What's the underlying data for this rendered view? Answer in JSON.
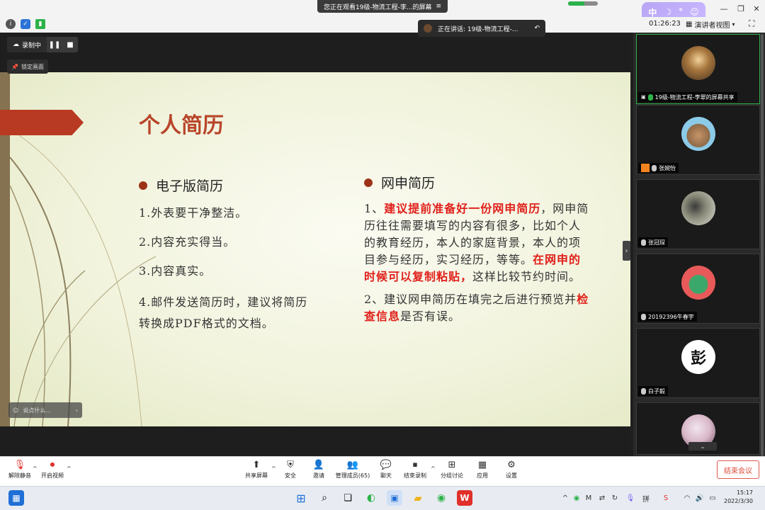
{
  "window": {
    "share_banner": "您正在观看19级-物流工程-李...的屏幕",
    "ime": [
      "中",
      "☽",
      "°",
      "☺"
    ],
    "signal_level": 0.55
  },
  "toolbar": {
    "timer": "01:26:23",
    "view_label": "演讲者视图",
    "view_caret": "▾"
  },
  "speaking": {
    "label": "正在讲话: 19级-物流工程-..."
  },
  "recording": {
    "label": "录制中",
    "pause": "❚❚",
    "stop": "■",
    "pin_label": "锁定画面"
  },
  "slide": {
    "title": "个人简历",
    "left": {
      "heading": "电子版简历",
      "items": [
        "1.外表要干净整洁。",
        "2.内容充实得当。",
        "3.内容真实。"
      ],
      "item4_a": "4.邮件发送简历时，建议将简历",
      "item4_b": "转换成PDF格式的文档。"
    },
    "right": {
      "heading": "网申简历",
      "p1_prefix": "1、",
      "p1_red": "建议提前准备好一份网申简历",
      "p1_after": "，网申简历往往需要填写的内容有很多，比如个人的教育经历，本人的家庭背景，本人的项目参与经历，实习经历，等等。",
      "p1_red2": "在网申的时候可以复制粘贴，",
      "p1_end": "这样比较节约时间。",
      "p2_prefix": "2、建议网申简历在填完之后进行预览并",
      "p2_red": "检查信息",
      "p2_end": "是否有误。"
    },
    "chat_placeholder": "说点什么..."
  },
  "gallery": {
    "participants": [
      {
        "name": "19级-物流工程-李翠的屏幕共享",
        "avatar_color": "#6b4a2f",
        "mic_on": true
      },
      {
        "name": "张婉怡",
        "avatar_color": "#8ccbe8",
        "mic_on": false
      },
      {
        "name": "张冠琛",
        "avatar_color": "#cfd6c8",
        "mic_on": false
      },
      {
        "name": "20192396牛春宇",
        "avatar_color": "#e85a5a",
        "mic_on": false
      },
      {
        "name": "白子毅",
        "avatar_color": "#ffffff",
        "mic_on": false
      },
      {
        "name": "",
        "avatar_color": "#d8b7c8",
        "mic_on": false
      }
    ],
    "more": "⌄"
  },
  "controls": {
    "unmute": "解除静音",
    "start_video": "开启视频",
    "share_screen": "共享屏幕",
    "security": "安全",
    "invite": "邀请",
    "participants": "管理成员(65)",
    "chat": "聊天",
    "end_recording": "结束录制",
    "breakout": "分组讨论",
    "apps": "应用",
    "settings": "设置",
    "end_meeting": "结束会议"
  },
  "taskbar": {
    "time": "15:17",
    "date": "2022/3/30"
  }
}
